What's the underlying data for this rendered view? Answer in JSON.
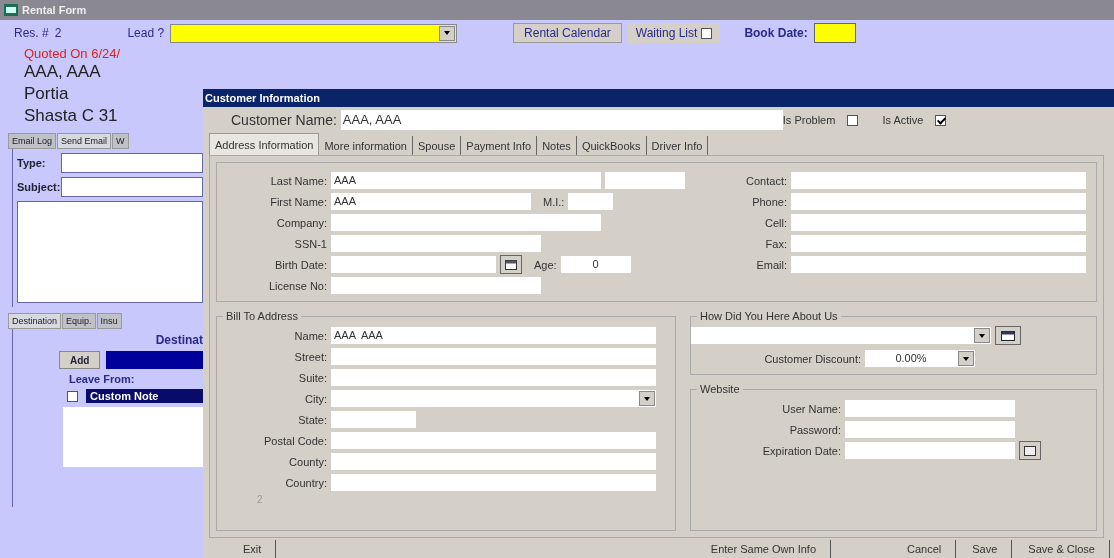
{
  "rental_form": {
    "title": "Rental Form",
    "res_label": "Res. #",
    "res_number": "2",
    "lead_label": "Lead ?",
    "rental_calendar_button": "Rental Calendar",
    "waiting_list": {
      "label": "Waiting List",
      "checked": false
    },
    "book_date_label": "Book Date:",
    "quoted_on": "Quoted On 6/24/",
    "customer": "AAA, AAA",
    "lines": [
      "Portia",
      "Shasta C 31"
    ],
    "email_tabs": [
      {
        "label": "Email Log",
        "selected": false
      },
      {
        "label": "Send Email",
        "selected": true
      },
      {
        "label": "W",
        "selected": false
      }
    ],
    "type_label": "Type:",
    "subject_label": "Subject:",
    "destination_tabs": [
      {
        "label": "Destination",
        "selected": true
      },
      {
        "label": "Equip.",
        "selected": false
      },
      {
        "label": "Insu",
        "selected": false
      }
    ],
    "destination_label": "Destinat",
    "add_button": "Add",
    "leave_from_label": "Leave From:",
    "custom_note": {
      "label": "Custom Note",
      "checked": false
    }
  },
  "dialog": {
    "title": "Customer Information",
    "customer_name_label": "Customer Name:",
    "customer_name": "AAA, AAA",
    "flags": [
      {
        "label": "Is Problem",
        "checked": false
      },
      {
        "label": "Is Active",
        "checked": true
      }
    ],
    "tabs": [
      {
        "label": "Address Information",
        "selected": true
      },
      {
        "label": "More information",
        "selected": false
      },
      {
        "label": "Spouse",
        "selected": false
      },
      {
        "label": "Payment Info",
        "selected": false
      },
      {
        "label": "Notes",
        "selected": false
      },
      {
        "label": "QuickBooks",
        "selected": false
      },
      {
        "label": "Driver Info",
        "selected": false
      }
    ],
    "personal": [
      {
        "label": "Last Name:",
        "value": "AAA",
        "kind": "extra"
      },
      {
        "label": "First Name:",
        "value": "AAA",
        "kind": "mi",
        "mi_label": "M.I.:"
      },
      {
        "label": "Company:",
        "kind": "text"
      },
      {
        "label": "SSN-1",
        "kind": "short"
      },
      {
        "label": "Birth Date:",
        "kind": "age",
        "age_label": "Age:",
        "age": "0"
      },
      {
        "label": "License No:",
        "kind": "short"
      }
    ],
    "contact": [
      {
        "label": "Contact:",
        "kind": "text"
      },
      {
        "label": "Phone:",
        "kind": "text"
      },
      {
        "label": "Cell:",
        "kind": "text"
      },
      {
        "label": "Fax:",
        "kind": "text"
      },
      {
        "label": "Email:",
        "kind": "text"
      }
    ],
    "bill_to": {
      "title": "Bill To Address",
      "fields": [
        {
          "label": "Name:",
          "value": "AAA  AAA",
          "kind": "text"
        },
        {
          "label": "Street:",
          "kind": "text"
        },
        {
          "label": "Suite:",
          "kind": "text"
        },
        {
          "label": "City:",
          "kind": "combo"
        },
        {
          "label": "State:",
          "kind": "tiny"
        },
        {
          "label": "Postal Code:",
          "kind": "text"
        },
        {
          "label": "County:",
          "kind": "text"
        },
        {
          "label": "Country:",
          "kind": "text"
        }
      ],
      "footnote": "2"
    },
    "referral": {
      "title": "How Did You Here About Us",
      "discount_label": "Customer Discount:",
      "discount": "0.00%"
    },
    "website": {
      "title": "Website",
      "fields": [
        {
          "label": "User Name:",
          "kind": "text"
        },
        {
          "label": "Password:",
          "kind": "text"
        },
        {
          "label": "Expiration Date:",
          "kind": "date"
        }
      ]
    },
    "buttons": [
      "Exit",
      "Enter Same Own Info",
      "Cancel",
      "Save",
      "Save & Close"
    ]
  }
}
